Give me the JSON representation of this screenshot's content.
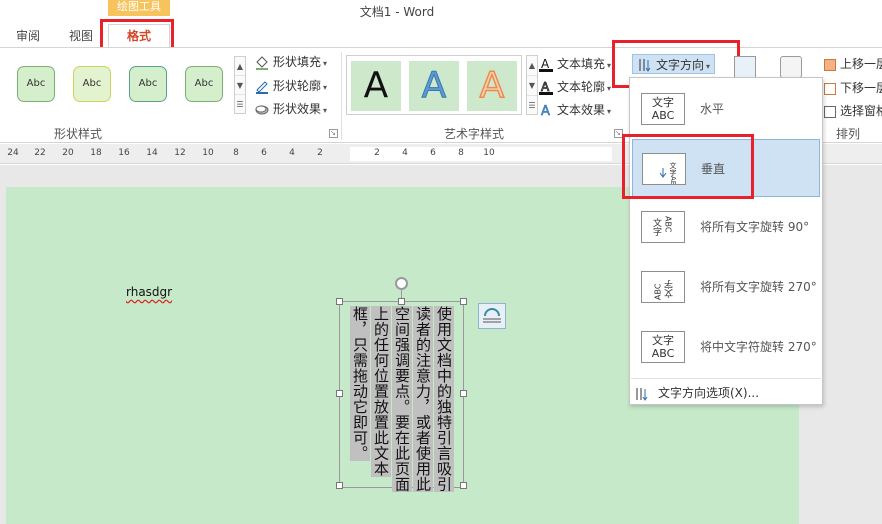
{
  "title_bar": {
    "document_title": "文档1 - Word",
    "contextual_tab_label": "绘图工具"
  },
  "tabs": [
    {
      "label": "审阅"
    },
    {
      "label": "视图"
    },
    {
      "label": "格式",
      "active": true
    }
  ],
  "ribbon": {
    "shape_styles": {
      "swatch_label": "Abc",
      "commands": [
        {
          "label": "形状填充",
          "icon": "paint-bucket-icon"
        },
        {
          "label": "形状轮廓",
          "icon": "pencil-icon"
        },
        {
          "label": "形状效果",
          "icon": "shape-effects-icon"
        }
      ],
      "group_label": "形状样式"
    },
    "wordart_styles": {
      "samples": [
        {
          "glyph": "A",
          "color": "#111111"
        },
        {
          "glyph": "A",
          "color": "#5b9bd5"
        },
        {
          "glyph": "A",
          "color": "#f4b183"
        }
      ],
      "commands": [
        {
          "label": "文本填充",
          "icon": "text-fill-icon"
        },
        {
          "label": "文本轮廓",
          "icon": "text-outline-icon"
        },
        {
          "label": "文本效果",
          "icon": "text-effects-icon"
        }
      ],
      "group_label": "艺术字样式"
    },
    "text_direction_button": {
      "label": "文字方向",
      "icon": "text-direction-icon"
    },
    "arrange": {
      "commands": [
        {
          "label": "上移一层"
        },
        {
          "label": "下移一层"
        },
        {
          "label": "选择窗格"
        }
      ],
      "group_label": "排列"
    }
  },
  "ruler": {
    "left_ticks": [
      "24",
      "22",
      "20",
      "18",
      "16",
      "14",
      "12",
      "10",
      "8",
      "6",
      "4",
      "2"
    ],
    "right_ticks": [
      "2",
      "4",
      "6",
      "8",
      "10"
    ]
  },
  "document": {
    "body_text": "rhasdgr",
    "textbox_columns": [
      "使用文档中的独特引言吸引",
      "读者的注意力，或者使用此",
      "空间强调要点。要在此页面",
      "上的任何位置放置此文本",
      "框，只需拖动它即可。"
    ]
  },
  "text_direction_menu": {
    "items": [
      {
        "label": "水平",
        "icon": "horizontal-text-icon",
        "icon_text": "文字\nABC"
      },
      {
        "label": "垂直",
        "icon": "vertical-text-icon",
        "icon_text": "文字ABC",
        "selected": true
      },
      {
        "label": "将所有文字旋转 90°",
        "icon": "rotate-90-icon",
        "icon_text": "文字ABC"
      },
      {
        "label": "将所有文字旋转 270°",
        "icon": "rotate-270-icon",
        "icon_text": "文字ABC"
      },
      {
        "label": "将中文字符旋转 270°",
        "icon": "rotate-cjk-270-icon",
        "icon_text": "文字ABC"
      }
    ],
    "footer": {
      "label": "文字方向选项(X)...",
      "icon": "text-direction-options-icon"
    }
  },
  "colors": {
    "accent": "#d24726",
    "contextual": "#f6c35c",
    "highlight": "#e8212b",
    "page": "#c6e9c9",
    "menu_selected": "#cfe2f4"
  }
}
